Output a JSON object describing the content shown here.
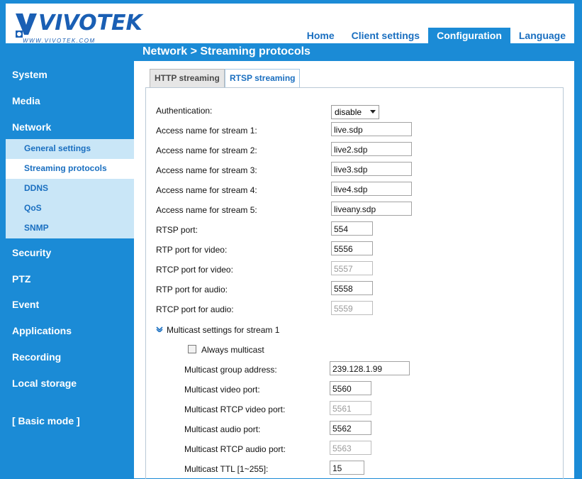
{
  "brand": {
    "logo_text": "VIVOTEK",
    "logo_sub": "WWW.VIVOTEK.COM"
  },
  "topnav": [
    "Home",
    "Client settings",
    "Configuration",
    "Language"
  ],
  "breadcrumb": "Network  > Streaming protocols",
  "sidebar": {
    "system": "System",
    "media": "Media",
    "network": "Network",
    "sub": [
      "General settings",
      "Streaming protocols",
      "DDNS",
      "QoS",
      "SNMP"
    ],
    "security": "Security",
    "ptz": "PTZ",
    "event": "Event",
    "applications": "Applications",
    "recording": "Recording",
    "local_storage": "Local storage",
    "basic_mode": "[ Basic mode ]"
  },
  "tabs": {
    "http": "HTTP streaming",
    "rtsp": "RTSP streaming"
  },
  "form": {
    "authentication": {
      "label": "Authentication:",
      "value": "disable"
    },
    "fields": [
      {
        "label": "Access name for stream 1:",
        "value": "live.sdp"
      },
      {
        "label": "Access name for stream 2:",
        "value": "live2.sdp"
      },
      {
        "label": "Access name for stream 3:",
        "value": "live3.sdp"
      },
      {
        "label": "Access name for stream 4:",
        "value": "live4.sdp"
      },
      {
        "label": "Access name for stream 5:",
        "value": "liveany.sdp"
      },
      {
        "label": "RTSP port:",
        "value": "554"
      },
      {
        "label": "RTP port for video:",
        "value": "5556"
      },
      {
        "label": "RTCP port for video:",
        "value": "5557"
      },
      {
        "label": "RTP port for audio:",
        "value": "5558"
      },
      {
        "label": "RTCP port for audio:",
        "value": "5559"
      }
    ],
    "multicast_heading": "Multicast settings for stream 1",
    "always_multicast": "Always multicast",
    "multicast": [
      {
        "label": "Multicast group address:",
        "value": "239.128.1.99"
      },
      {
        "label": "Multicast video port:",
        "value": "5560"
      },
      {
        "label": "Multicast RTCP video port:",
        "value": "5561"
      },
      {
        "label": "Multicast audio port:",
        "value": "5562"
      },
      {
        "label": "Multicast RTCP audio port:",
        "value": "5563"
      },
      {
        "label": "Multicast TTL [1~255]:",
        "value": "15"
      }
    ]
  }
}
